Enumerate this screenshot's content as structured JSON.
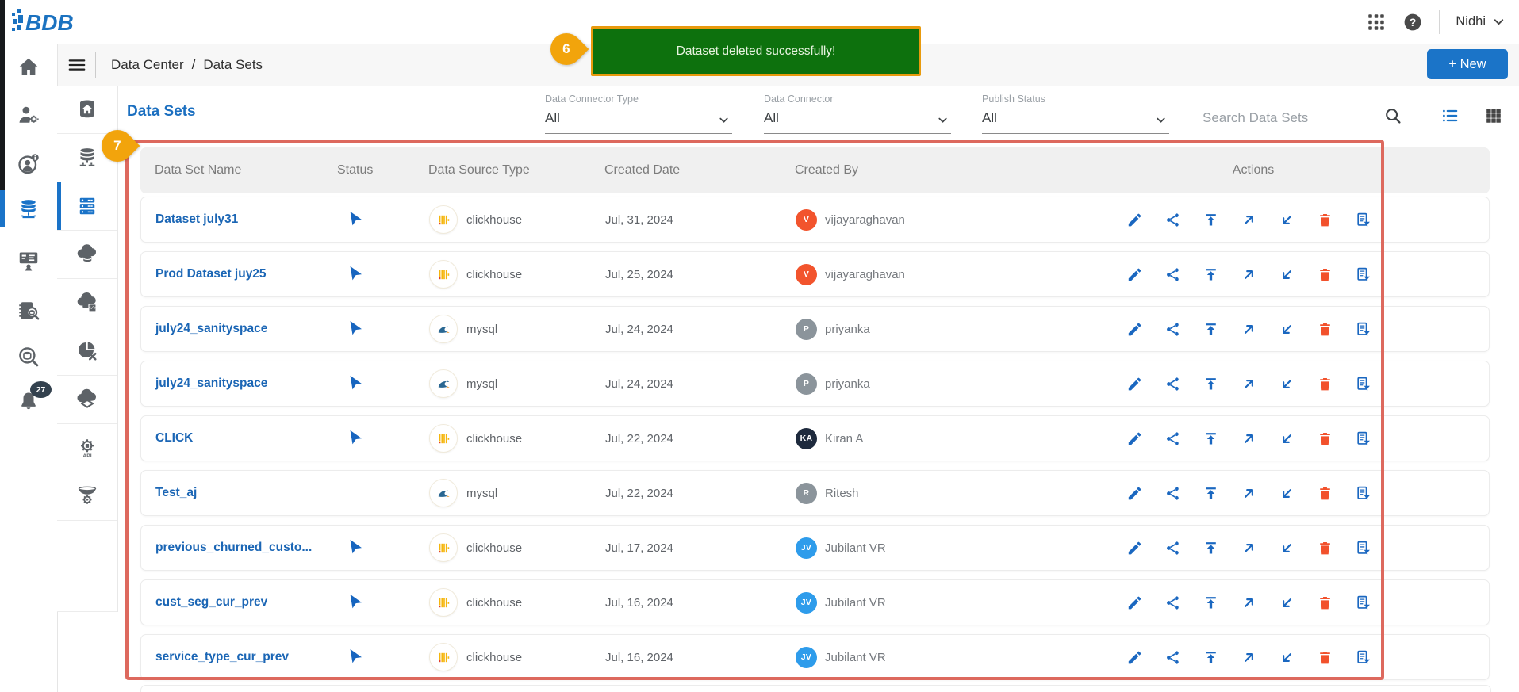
{
  "header": {
    "logo_text": "BDB",
    "user_name": "Nidhi",
    "icons": [
      "apps-grid-icon",
      "help-icon",
      "chevron-down-icon"
    ]
  },
  "breadcrumb": {
    "items": [
      "Data Center",
      "Data Sets"
    ],
    "separator": "/"
  },
  "page": {
    "title": "Data Sets",
    "new_button_label": "+ New"
  },
  "toast": {
    "message": "Dataset deleted successfully!",
    "bg_color": "#0d710d",
    "border_color": "#e89a0d"
  },
  "annotations": {
    "toast_step": "6",
    "table_step": "7",
    "balloon_color": "#f2a40c",
    "box_color": "#dd695e"
  },
  "filters": {
    "items": [
      {
        "label": "Data Connector Type",
        "value": "All"
      },
      {
        "label": "Data Connector",
        "value": "All"
      },
      {
        "label": "Publish Status",
        "value": "All"
      }
    ],
    "search_placeholder": "Search Data Sets",
    "view_icons": [
      "search-icon",
      "list-view-icon",
      "grid-view-icon"
    ]
  },
  "sidebar_primary": [
    {
      "name": "home",
      "icon": "home-icon"
    },
    {
      "name": "user-management",
      "icon": "user-gear-icon"
    },
    {
      "name": "account-info",
      "icon": "user-info-icon"
    },
    {
      "name": "data-center",
      "icon": "database-icon",
      "active": true
    },
    {
      "name": "presentation",
      "icon": "board-user-icon"
    },
    {
      "name": "data-catalog",
      "icon": "notebook-search-icon"
    },
    {
      "name": "data-search",
      "icon": "search-database-icon"
    },
    {
      "name": "notifications",
      "icon": "bell-icon",
      "badge": "27"
    }
  ],
  "sidebar_secondary": [
    {
      "name": "data-center-home",
      "icon": "database-home-icon"
    },
    {
      "name": "data-connectors",
      "icon": "database-stack-icon"
    },
    {
      "name": "data-sets",
      "icon": "dataset-racks-icon",
      "active": true
    },
    {
      "name": "data-stores",
      "icon": "cloud-database-icon"
    },
    {
      "name": "data-store-metadata",
      "icon": "cloud-code-icon"
    },
    {
      "name": "data-preparation",
      "icon": "pie-sync-icon"
    },
    {
      "name": "data-sheets",
      "icon": "cloud-layers-icon"
    },
    {
      "name": "api-services",
      "icon": "api-gear-icon"
    },
    {
      "name": "etl",
      "icon": "funnel-gear-icon"
    }
  ],
  "table": {
    "columns": [
      "Data Set Name",
      "Status",
      "Data Source Type",
      "Created Date",
      "Created By",
      "Actions"
    ],
    "status_icon": "nav-arrow-icon",
    "source_icons": {
      "clickhouse": "clickhouse-icon",
      "mysql": "mysql-icon"
    },
    "rows": [
      {
        "name": "Dataset july31",
        "published": true,
        "source": "clickhouse",
        "date": "Jul, 31, 2024",
        "creator": {
          "initials": "V",
          "name": "vijayaraghavan",
          "color": "#f2542d"
        }
      },
      {
        "name": "Prod Dataset juy25",
        "published": true,
        "source": "clickhouse",
        "date": "Jul, 25, 2024",
        "creator": {
          "initials": "V",
          "name": "vijayaraghavan",
          "color": "#f2542d"
        }
      },
      {
        "name": "july24_sanityspace",
        "published": true,
        "source": "mysql",
        "date": "Jul, 24, 2024",
        "creator": {
          "initials": "P",
          "name": "priyanka",
          "color": "#8b949b"
        }
      },
      {
        "name": "july24_sanityspace",
        "published": true,
        "source": "mysql",
        "date": "Jul, 24, 2024",
        "creator": {
          "initials": "P",
          "name": "priyanka",
          "color": "#8b949b"
        }
      },
      {
        "name": "CLICK",
        "published": true,
        "source": "clickhouse",
        "date": "Jul, 22, 2024",
        "creator": {
          "initials": "KA",
          "name": "Kiran A",
          "color": "#1e2a3d"
        }
      },
      {
        "name": "Test_aj",
        "published": false,
        "source": "mysql",
        "date": "Jul, 22, 2024",
        "creator": {
          "initials": "R",
          "name": "Ritesh",
          "color": "#8b949b"
        }
      },
      {
        "name": "previous_churned_custo...",
        "published": true,
        "source": "clickhouse",
        "date": "Jul, 17, 2024",
        "creator": {
          "initials": "JV",
          "name": "Jubilant VR",
          "color": "#2e9ceb"
        }
      },
      {
        "name": "cust_seg_cur_prev",
        "published": true,
        "source": "clickhouse",
        "date": "Jul, 16, 2024",
        "creator": {
          "initials": "JV",
          "name": "Jubilant VR",
          "color": "#2e9ceb"
        }
      },
      {
        "name": "service_type_cur_prev",
        "published": true,
        "source": "clickhouse",
        "date": "Jul, 16, 2024",
        "creator": {
          "initials": "JV",
          "name": "Jubilant VR",
          "color": "#2e9ceb"
        }
      }
    ]
  },
  "actions": [
    {
      "label": "edit",
      "icon": "pencil-icon",
      "color": "#1a67c0"
    },
    {
      "label": "share",
      "icon": "share-icon",
      "color": "#1a67c0"
    },
    {
      "label": "publish",
      "icon": "upload-icon",
      "color": "#1a67c0"
    },
    {
      "label": "push-to-prod",
      "icon": "arrow-up-right-icon",
      "color": "#1a67c0"
    },
    {
      "label": "pull-from-prod",
      "icon": "arrow-down-left-icon",
      "color": "#1a67c0"
    },
    {
      "label": "delete",
      "icon": "trash-icon",
      "color": "#f2512c"
    },
    {
      "label": "copy-with-filter",
      "icon": "document-filter-icon",
      "color": "#1a67c0"
    }
  ]
}
